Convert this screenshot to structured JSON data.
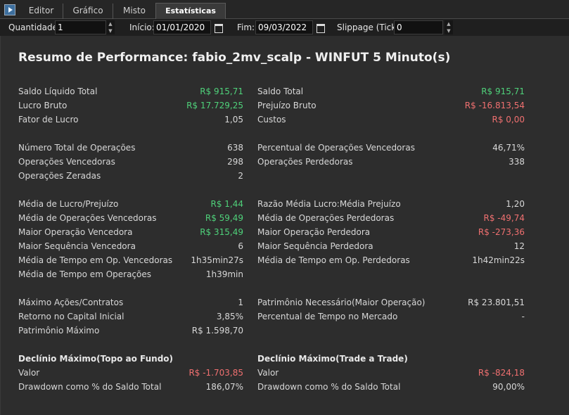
{
  "tabs": [
    "Editor",
    "Gráfico",
    "Misto",
    "Estatísticas"
  ],
  "params": {
    "quantidade_label": "Quantidade:",
    "quantidade_value": "1",
    "inicio_label": "Início:",
    "inicio_value": "01/01/2020",
    "fim_label": "Fim:",
    "fim_value": "09/03/2022",
    "slippage_label": "Slippage (Ticks):",
    "slippage_value": "0"
  },
  "title": "Resumo de Performance: fabio_2mv_scalp - WINFUT 5 Minuto(s)",
  "left": [
    {
      "label": "Saldo Líquido Total",
      "value": "R$ 915,71",
      "color": "green"
    },
    {
      "label": "Lucro Bruto",
      "value": "R$ 17.729,25",
      "color": "green"
    },
    {
      "label": "Fator de Lucro",
      "value": "1,05",
      "color": ""
    },
    {
      "label": "Número Total de Operações",
      "value": "638",
      "color": ""
    },
    {
      "label": "Operações Vencedoras",
      "value": "298",
      "color": ""
    },
    {
      "label": "Operações Zeradas",
      "value": "2",
      "color": ""
    },
    {
      "label": "Média de Lucro/Prejuízo",
      "value": "R$ 1,44",
      "color": "green"
    },
    {
      "label": "Média de Operações Vencedoras",
      "value": "R$ 59,49",
      "color": "green"
    },
    {
      "label": "Maior Operação Vencedora",
      "value": "R$ 315,49",
      "color": "green"
    },
    {
      "label": "Maior Sequência Vencedora",
      "value": "6",
      "color": ""
    },
    {
      "label": "Média de Tempo em Op. Vencedoras",
      "value": "1h35min27s",
      "color": ""
    },
    {
      "label": "Média de Tempo em Operações",
      "value": "1h39min",
      "color": ""
    },
    {
      "label": "Máximo Ações/Contratos",
      "value": "1",
      "color": ""
    },
    {
      "label": "Retorno no Capital Inicial",
      "value": "3,85%",
      "color": ""
    },
    {
      "label": "Patrimônio Máximo",
      "value": "R$ 1.598,70",
      "color": ""
    }
  ],
  "right": [
    {
      "label": "Saldo Total",
      "value": "R$ 915,71",
      "color": "green"
    },
    {
      "label": "Prejuízo Bruto",
      "value": "R$ -16.813,54",
      "color": "red"
    },
    {
      "label": "Custos",
      "value": "R$ 0,00",
      "color": "red"
    },
    {
      "label": "Percentual de Operações Vencedoras",
      "value": "46,71%",
      "color": ""
    },
    {
      "label": "Operações Perdedoras",
      "value": "338",
      "color": ""
    },
    {
      "label": "Razão Média Lucro:Média Prejuízo",
      "value": "1,20",
      "color": ""
    },
    {
      "label": "Média de Operações Perdedoras",
      "value": "R$ -49,74",
      "color": "red"
    },
    {
      "label": "Maior Operação Perdedora",
      "value": "R$ -273,36",
      "color": "red"
    },
    {
      "label": "Maior Sequência Perdedora",
      "value": "12",
      "color": ""
    },
    {
      "label": "Média de Tempo em Op. Perdedoras",
      "value": "1h42min22s",
      "color": ""
    },
    {
      "label": "Patrimônio Necessário(Maior Operação)",
      "value": "R$ 23.801,51",
      "color": ""
    },
    {
      "label": "Percentual de Tempo no Mercado",
      "value": "-",
      "color": ""
    }
  ],
  "drawdown_left": {
    "heading": "Declínio Máximo(Topo ao Fundo)",
    "rows": [
      {
        "label": "Valor",
        "value": "R$ -1.703,85",
        "color": "red"
      },
      {
        "label": "Drawdown como % do Saldo Total",
        "value": "186,07%",
        "color": ""
      }
    ]
  },
  "drawdown_right": {
    "heading": "Declínio Máximo(Trade a Trade)",
    "rows": [
      {
        "label": "Valor",
        "value": "R$ -824,18",
        "color": "red"
      },
      {
        "label": "Drawdown como % do Saldo Total",
        "value": "90,00%",
        "color": ""
      }
    ]
  },
  "colors": {
    "positive": "#4fd17a",
    "negative": "#f07070",
    "background": "#2d2d2d"
  }
}
